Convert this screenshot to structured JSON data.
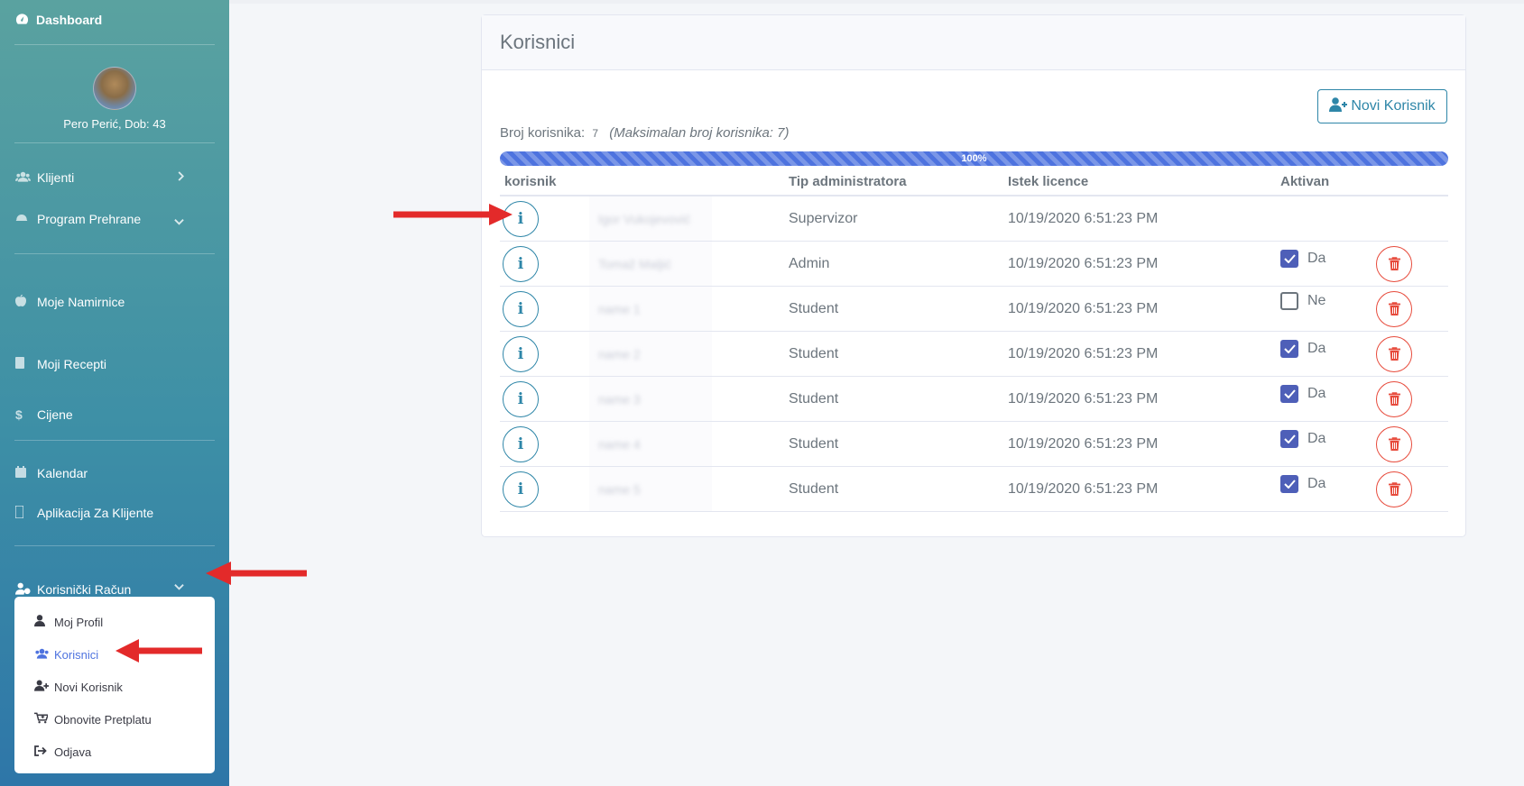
{
  "sidebar": {
    "brand": "Dashboard",
    "user_name": "Pero Perić, Dob: 43",
    "items": [
      {
        "label": "Klijenti"
      },
      {
        "label": "Program Prehrane"
      },
      {
        "label": "Moje Namirnice"
      },
      {
        "label": "Moji Recepti"
      },
      {
        "label": "Cijene"
      },
      {
        "label": "Kalendar"
      },
      {
        "label": "Aplikacija Za Klijente"
      },
      {
        "label": "Korisnički Račun"
      }
    ],
    "submenu": [
      {
        "label": "Moj Profil"
      },
      {
        "label": "Korisnici"
      },
      {
        "label": "Novi Korisnik"
      },
      {
        "label": "Obnovite Pretplatu"
      },
      {
        "label": "Odjava"
      }
    ]
  },
  "card": {
    "title": "Korisnici",
    "new_button": "Novi Korisnik",
    "count_label": "Broj korisnika:",
    "count_value": "7",
    "max_label": "(Maksimalan broj korisnika: 7)",
    "progress_label": "100%",
    "progress_value": 100
  },
  "table": {
    "headers": {
      "user": "korisnik",
      "type": "Tip administratora",
      "expiry": "Istek licence",
      "active": "Aktivan"
    },
    "rows": [
      {
        "name": "Igor Vukojevović",
        "type": "Supervizor",
        "expiry": "10/19/2020 6:51:23 PM",
        "active": null,
        "active_label": ""
      },
      {
        "name": "Tomaž Maljić",
        "type": "Admin",
        "expiry": "10/19/2020 6:51:23 PM",
        "active": true,
        "active_label": "Da"
      },
      {
        "name": "name 1",
        "type": "Student",
        "expiry": "10/19/2020 6:51:23 PM",
        "active": false,
        "active_label": "Ne"
      },
      {
        "name": "name 2",
        "type": "Student",
        "expiry": "10/19/2020 6:51:23 PM",
        "active": true,
        "active_label": "Da"
      },
      {
        "name": "name 3",
        "type": "Student",
        "expiry": "10/19/2020 6:51:23 PM",
        "active": true,
        "active_label": "Da"
      },
      {
        "name": "name 4",
        "type": "Student",
        "expiry": "10/19/2020 6:51:23 PM",
        "active": true,
        "active_label": "Da"
      },
      {
        "name": "name 5",
        "type": "Student",
        "expiry": "10/19/2020 6:51:23 PM",
        "active": true,
        "active_label": "Da"
      }
    ]
  },
  "colors": {
    "accent": "#4e73df",
    "info": "#2e86a8",
    "danger": "#e74a3b",
    "annotation": "#e32a2a"
  },
  "icons": {
    "brand": "speedometer-icon",
    "info": "info-icon",
    "delete": "trash-icon",
    "check": "checkmark-icon"
  }
}
